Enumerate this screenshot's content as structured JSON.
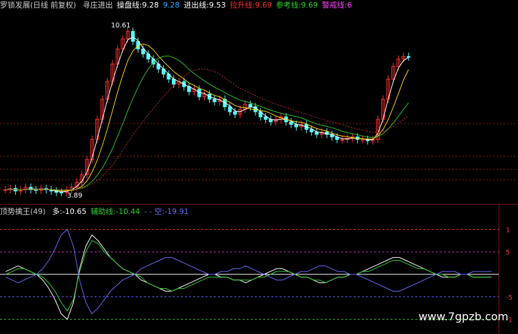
{
  "header": {
    "indicator": "罗锁发展(日线 前复权)",
    "items": [
      {
        "label": "寻庄进出",
        "color": "#d8d8d8"
      },
      {
        "label": "操盘线:",
        "value": "9.28",
        "color": "#ffffff"
      },
      {
        "label": "",
        "value": "9.28",
        "color": "#2aa8ff"
      },
      {
        "label": "进出线:",
        "value": "9.53",
        "color": "#ffffff"
      },
      {
        "label": "拉升线:",
        "value": "9.69",
        "color": "#ff3030"
      },
      {
        "label": "参考线:",
        "value": "9.69",
        "color": "#30d030"
      },
      {
        "label": "警戒线:",
        "value": "6",
        "color": "#ff40ff"
      }
    ]
  },
  "osc_header": {
    "name": "顶势擒王(49)",
    "items": [
      {
        "label": "多:",
        "value": "-10.65",
        "color": "#ffffff"
      },
      {
        "label": "辅助线:",
        "value": "-10.44",
        "color": "#30d030"
      },
      {
        "label": "- - 空:",
        "value": "-19.91",
        "color": "#6a6aff"
      }
    ]
  },
  "annotations": {
    "high": "10.61",
    "low": "3.89"
  },
  "osc_axis": {
    "ticks": [
      "1",
      "5",
      "-5",
      "-1"
    ]
  },
  "watermark": "www.7gpzb.com",
  "colors": {
    "up": "#ff3030",
    "down": "#54ffff",
    "ma_white": "#ffffff",
    "ma_yellow": "#ffd700",
    "ma_green": "#30c030",
    "ma_red": "#c03030",
    "grid": "#8b1a1a"
  },
  "chart_data": [
    {
      "type": "candlestick",
      "description_series": [
        "close"
      ],
      "ylim": [
        3.5,
        11
      ],
      "close": [
        4.0,
        4.05,
        3.95,
        4.0,
        4.1,
        4.0,
        3.98,
        4.05,
        4.0,
        3.95,
        3.9,
        3.89,
        4.0,
        4.1,
        4.3,
        4.6,
        5.2,
        6.0,
        6.8,
        7.6,
        8.3,
        9.0,
        9.6,
        10.0,
        10.3,
        9.9,
        9.6,
        9.4,
        9.2,
        9.0,
        8.8,
        8.6,
        8.4,
        8.2,
        8.3,
        8.1,
        7.9,
        8.0,
        7.7,
        7.8,
        7.6,
        7.5,
        7.6,
        7.3,
        7.1,
        7.0,
        7.2,
        7.4,
        7.3,
        7.1,
        6.9,
        6.8,
        6.7,
        6.8,
        6.9,
        6.7,
        6.6,
        6.5,
        6.6,
        6.4,
        6.3,
        6.2,
        6.3,
        6.2,
        6.1,
        6.0,
        6.0,
        6.05,
        6.1,
        6.0,
        6.0,
        5.95,
        6.0,
        6.8,
        7.6,
        8.4,
        8.9,
        9.2,
        9.3,
        9.28
      ]
    },
    {
      "type": "line",
      "series_note": "oscillator lines, values in osc units",
      "ylim": [
        -20,
        20
      ],
      "series": [
        {
          "color": "#ffffff",
          "values": [
            1,
            2,
            3,
            2,
            1,
            0,
            -2,
            -5,
            -9,
            -14,
            -16,
            -10,
            2,
            10,
            14,
            12,
            9,
            6,
            4,
            2,
            1,
            0,
            -2,
            -3,
            -4,
            -5,
            -6,
            -6,
            -5,
            -4,
            -3,
            -2,
            -1,
            0,
            0,
            -1,
            -1,
            -2,
            -2,
            -3,
            -2,
            -1,
            0,
            1,
            2,
            2,
            1,
            0,
            -1,
            -1,
            -2,
            -3,
            -3,
            -2,
            -1,
            -1,
            0,
            0,
            1,
            2,
            3,
            4,
            5,
            6,
            6,
            5,
            4,
            3,
            2,
            1,
            0,
            -1,
            -1,
            -1,
            0,
            0,
            -1,
            -1,
            -1,
            -1
          ]
        },
        {
          "color": "#30d030",
          "values": [
            0,
            1,
            2,
            2,
            1,
            0,
            -1,
            -3,
            -6,
            -10,
            -13,
            -9,
            1,
            8,
            12,
            11,
            8,
            6,
            4,
            2,
            1,
            0,
            -1,
            -3,
            -4,
            -5,
            -5,
            -6,
            -5,
            -5,
            -4,
            -3,
            -2,
            -1,
            -1,
            -1,
            -1,
            -2,
            -2,
            -2,
            -2,
            -1,
            -1,
            0,
            1,
            1,
            1,
            0,
            -1,
            -1,
            -2,
            -2,
            -3,
            -2,
            -1,
            -1,
            0,
            0,
            1,
            1,
            2,
            3,
            4,
            5,
            5,
            4,
            3,
            2,
            2,
            1,
            0,
            0,
            -1,
            -1,
            0,
            0,
            -1,
            -1,
            -1,
            -1
          ]
        },
        {
          "color": "#6a6aff",
          "values": [
            -1,
            -2,
            -3,
            -2,
            -1,
            0,
            2,
            5,
            9,
            14,
            16,
            10,
            -2,
            -10,
            -14,
            -12,
            -9,
            -6,
            -4,
            -2,
            -1,
            0,
            2,
            3,
            4,
            5,
            6,
            6,
            5,
            4,
            3,
            2,
            1,
            0,
            0,
            1,
            1,
            2,
            2,
            3,
            2,
            1,
            0,
            -1,
            -2,
            -2,
            -1,
            0,
            1,
            1,
            2,
            3,
            3,
            2,
            1,
            1,
            0,
            0,
            -1,
            -2,
            -3,
            -4,
            -5,
            -6,
            -6,
            -5,
            -4,
            -3,
            -2,
            -1,
            0,
            1,
            1,
            1,
            0,
            0,
            1,
            1,
            1,
            1
          ]
        }
      ]
    }
  ]
}
